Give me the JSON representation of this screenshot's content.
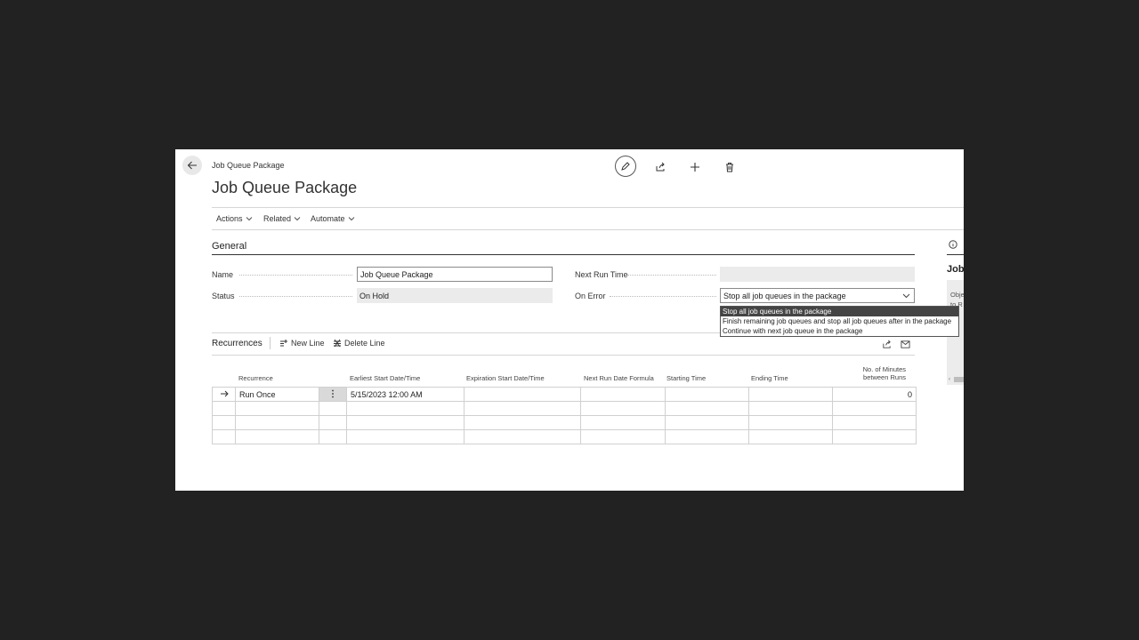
{
  "page": {
    "breadcrumb": "Job Queue Package",
    "title": "Job Queue Package"
  },
  "menu": {
    "actions": "Actions",
    "related": "Related",
    "automate": "Automate"
  },
  "general": {
    "section_title": "General",
    "name_label": "Name",
    "name_value": "Job Queue Package",
    "status_label": "Status",
    "status_value": "On Hold",
    "next_run_label": "Next Run Time",
    "next_run_value": "",
    "on_error_label": "On Error",
    "on_error_value": "Stop all job queues in the package",
    "on_error_options": [
      "Stop all job queues in the package",
      "Finish remaining job queues and stop all job queues after in the package",
      "Continue with next job queue in the package"
    ]
  },
  "recurrences": {
    "title": "Recurrences",
    "new_line": "New Line",
    "delete_line": "Delete Line",
    "columns": [
      "Recurrence",
      "Earliest Start Date/Time",
      "Expiration Start Date/Time",
      "Next Run Date Formula",
      "Starting Time",
      "Ending Time",
      "No. of Minutes",
      "between Runs"
    ],
    "rows": [
      {
        "recurrence": "Run Once",
        "earliest_start": "5/15/2023 12:00 AM",
        "minutes": "0"
      }
    ]
  },
  "side_panel": {
    "heading": "Job",
    "text1": "Obje",
    "text2": "to R"
  },
  "colors": {
    "background": "#222222",
    "window": "#ffffff",
    "selected_option": "#444444"
  }
}
